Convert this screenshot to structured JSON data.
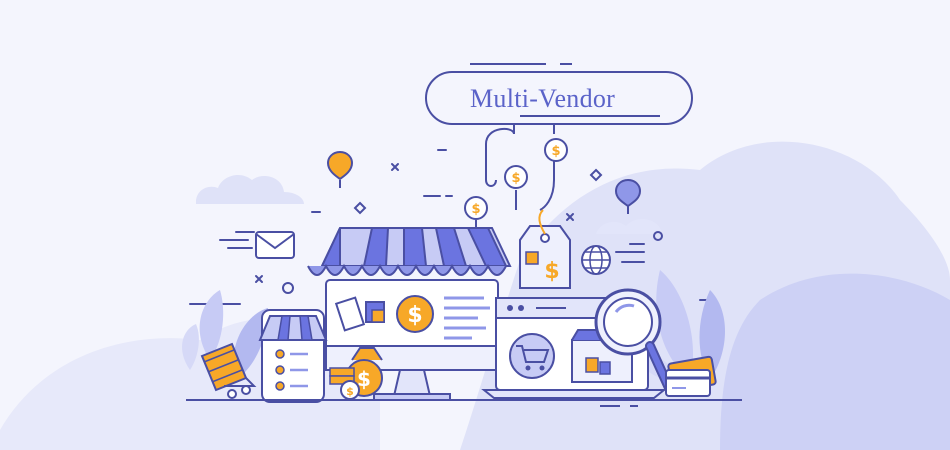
{
  "banner": {
    "title": "Multi-Vendor"
  },
  "colors": {
    "background": "#f4f5fd",
    "stroke": "#4a4fa3",
    "accent_blue": "#6b74e0",
    "accent_light": "#c7cbf5",
    "accent_orange": "#f7a828",
    "cloud": "#dfe2f8"
  },
  "icons": {
    "currency": "dollar-icon"
  },
  "currency_symbol": "$"
}
